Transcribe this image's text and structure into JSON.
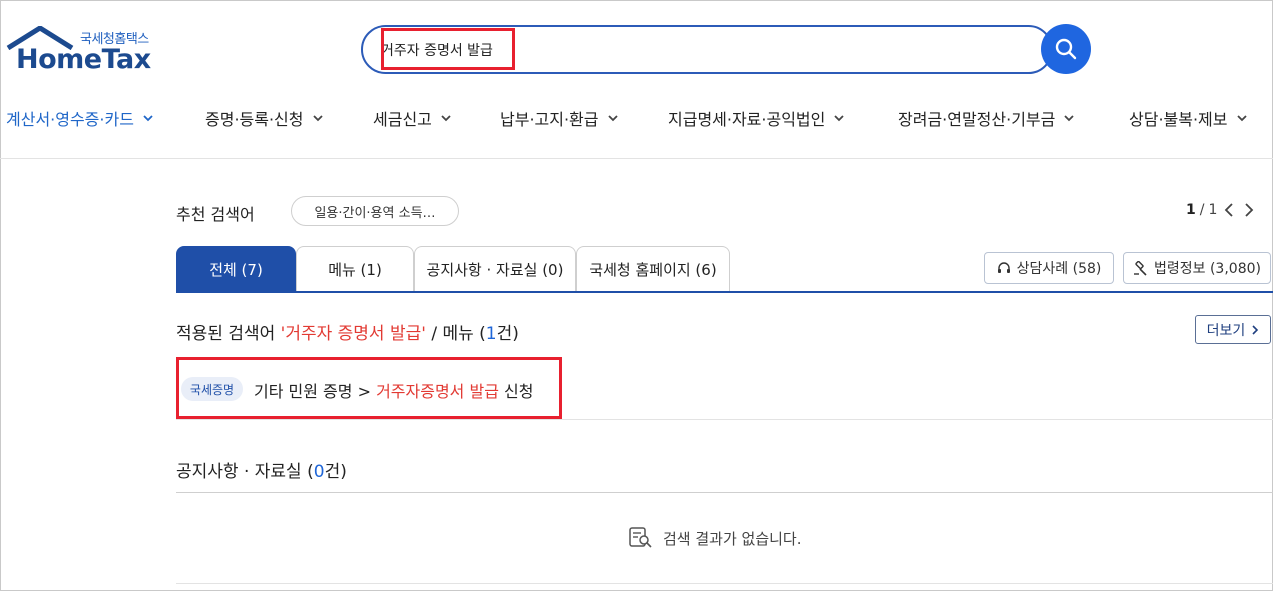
{
  "brand": {
    "sub": "국세청홈택스",
    "main": "HomeTax"
  },
  "search": {
    "value": "거주자 증명서 발급",
    "button_icon": "search-icon"
  },
  "nav": [
    {
      "label": "계산서·영수증·카드",
      "active": true
    },
    {
      "label": "증명·등록·신청",
      "active": false
    },
    {
      "label": "세금신고",
      "active": false
    },
    {
      "label": "납부·고지·환급",
      "active": false
    },
    {
      "label": "지급명세·자료·공익법인",
      "active": false
    },
    {
      "label": "장려금·연말정산·기부금",
      "active": false
    },
    {
      "label": "상담·불복·제보",
      "active": false
    }
  ],
  "recommended": {
    "label": "추천 검색어",
    "chip": "일용·간이·용역 소득…",
    "page_current": "1",
    "page_sep": "/",
    "page_total": "1"
  },
  "tabs": [
    {
      "label": "전체 (7)",
      "active": true
    },
    {
      "label": "메뉴 (1)",
      "active": false
    },
    {
      "label": "공지사항 · 자료실 (0)",
      "active": false
    },
    {
      "label": "국세청 홈페이지 (6)",
      "active": false
    }
  ],
  "side_buttons": {
    "consult": {
      "label": "상담사례 (58)",
      "icon": "headset-icon"
    },
    "law": {
      "label": "법령정보 (3,080)",
      "icon": "gavel-icon"
    }
  },
  "result": {
    "prefix": "적용된 검색어 ",
    "keyword": "'거주자 증명서 발급'",
    "middle": " / 메뉴 (",
    "count": "1",
    "suffix": "건)",
    "more": "더보기",
    "item": {
      "badge": "국세증명",
      "path": "기타 민원 증명 > ",
      "highlight": "거주자증명서 발급",
      "tail": " 신청"
    }
  },
  "notice": {
    "prefix": "공지사항 · 자료실 (",
    "count": "0",
    "suffix": "건)",
    "empty": "검색 결과가 없습니다."
  },
  "colors": {
    "primary": "#1f4fa8",
    "accent_blue": "#1f66e0",
    "highlight_red": "#e23a33",
    "annotation_red": "#e8202f"
  }
}
